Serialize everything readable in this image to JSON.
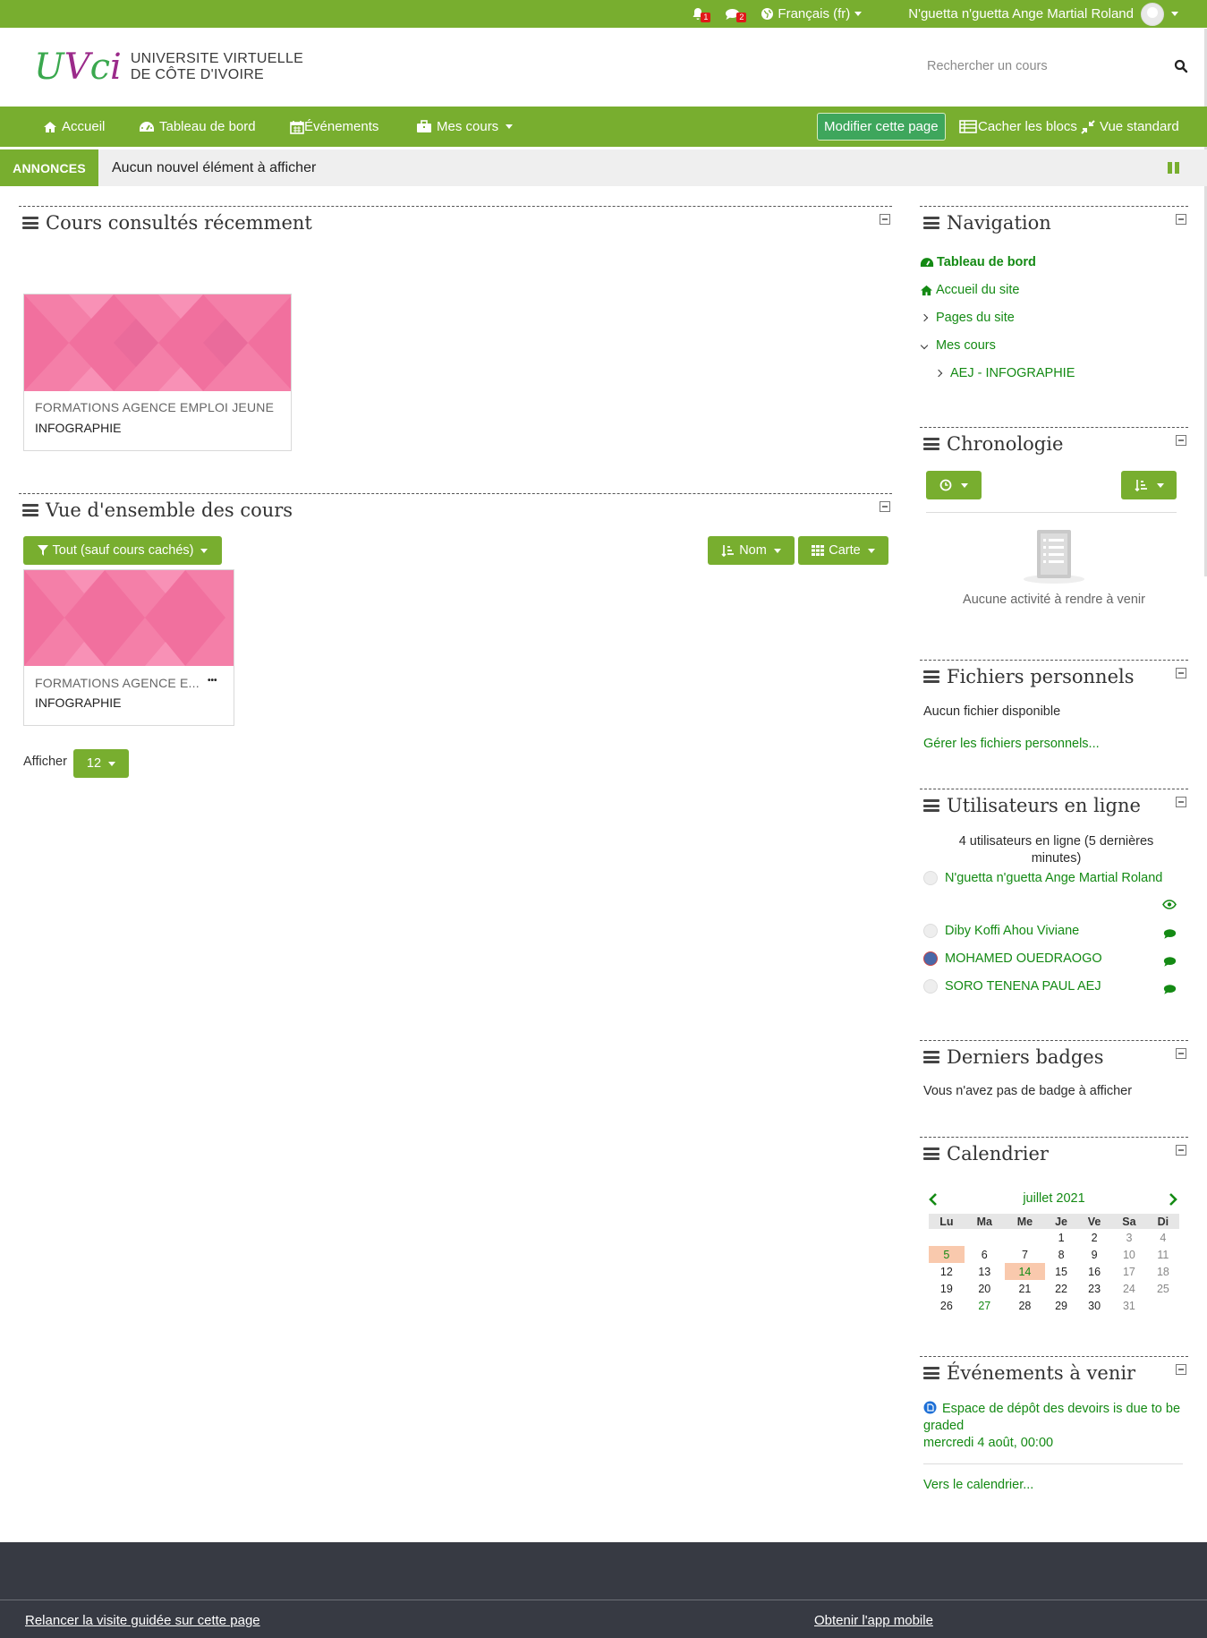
{
  "topbar": {
    "notifications_count": "1",
    "messages_count": "2",
    "language": "Français (fr)",
    "user_name": "N'guetta n'guetta Ange Martial Roland"
  },
  "header": {
    "logo_line1": "UNIVERSITE VIRTUELLE",
    "logo_line2": "DE CÔTE D'IVOIRE",
    "logo_mark_u": "U",
    "logo_mark_v": "V",
    "logo_mark_c": "c",
    "logo_mark_i": "i",
    "search_placeholder": "Rechercher un cours"
  },
  "nav": {
    "home": "Accueil",
    "dashboard": "Tableau de bord",
    "events": "Événements",
    "my_courses": "Mes cours",
    "edit_page": "Modifier cette page",
    "hide_blocks": "Cacher les blocs",
    "standard_view": "Vue standard"
  },
  "announcements": {
    "label": "ANNONCES",
    "message": "Aucun nouvel élément à afficher"
  },
  "recent": {
    "title": "Cours consultés récemment",
    "course_category": "FORMATIONS AGENCE EMPLOI JEUNE",
    "course_name": "INFOGRAPHIE"
  },
  "overview": {
    "title": "Vue d'ensemble des cours",
    "filter_label": "Tout (sauf cours cachés)",
    "sort_label": "Nom",
    "view_label": "Carte",
    "course_category": "FORMATIONS AGENCE E...",
    "course_name": "INFOGRAPHIE",
    "more_label": "•••",
    "show_label": "Afficher",
    "per_page": "12"
  },
  "navigation_block": {
    "title": "Navigation",
    "items": [
      "Tableau de bord",
      "Accueil du site",
      "Pages du site",
      "Mes cours",
      "AEJ - INFOGRAPHIE"
    ]
  },
  "timeline": {
    "title": "Chronologie",
    "empty": "Aucune activité à rendre à venir"
  },
  "files": {
    "title": "Fichiers personnels",
    "empty": "Aucun fichier disponible",
    "manage": "Gérer les fichiers personnels..."
  },
  "online": {
    "title": "Utilisateurs en ligne",
    "summary": "4 utilisateurs en ligne (5 dernières minutes)",
    "users": [
      "N'guetta n'guetta Ange Martial Roland",
      "Diby Koffi Ahou Viviane",
      "MOHAMED OUEDRAOGO",
      "SORO TENENA PAUL AEJ"
    ]
  },
  "badges": {
    "title": "Derniers badges",
    "empty": "Vous n'avez pas de badge à afficher"
  },
  "calendar": {
    "title": "Calendrier",
    "month": "juillet 2021",
    "days": [
      "Lu",
      "Ma",
      "Me",
      "Je",
      "Ve",
      "Sa",
      "Di"
    ],
    "weeks": [
      [
        "",
        "",
        "",
        "1",
        "2",
        "3",
        "4"
      ],
      [
        "5",
        "6",
        "7",
        "8",
        "9",
        "10",
        "11"
      ],
      [
        "12",
        "13",
        "14",
        "15",
        "16",
        "17",
        "18"
      ],
      [
        "19",
        "20",
        "21",
        "22",
        "23",
        "24",
        "25"
      ],
      [
        "26",
        "27",
        "28",
        "29",
        "30",
        "31",
        ""
      ]
    ]
  },
  "upcoming": {
    "title": "Événements à venir",
    "event_title": "Espace de dépôt des devoirs is due to be graded",
    "event_date": "mercredi 4 août",
    "event_time": ", 00:00",
    "to_calendar": "Vers le calendrier..."
  },
  "footer": {
    "tour": "Relancer la visite guidée sur cette page",
    "app": "Obtenir l'app mobile"
  },
  "colors": {
    "brand_green": "#78ae2f",
    "link_green": "#148a14",
    "footer_bg": "#373a43",
    "course_pink": "#f47fa8"
  }
}
